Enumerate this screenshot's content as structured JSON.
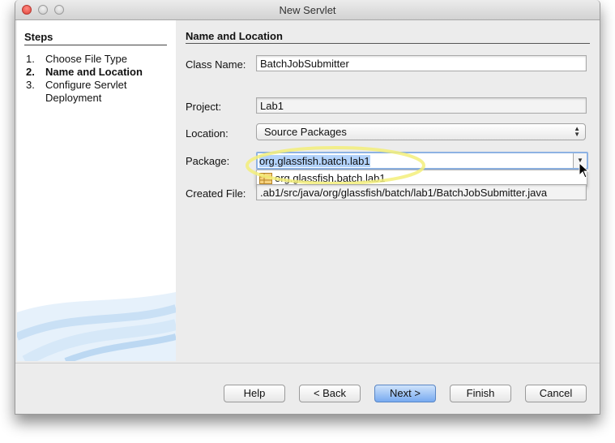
{
  "window": {
    "title": "New Servlet"
  },
  "steps": {
    "heading": "Steps",
    "items": [
      {
        "number": "1.",
        "label": "Choose File Type"
      },
      {
        "number": "2.",
        "label": "Name and Location"
      },
      {
        "number": "3.",
        "label": "Configure Servlet Deployment"
      }
    ]
  },
  "section": {
    "heading": "Name and Location"
  },
  "form": {
    "class_name": {
      "label": "Class Name:",
      "value": "BatchJobSubmitter"
    },
    "project": {
      "label": "Project:",
      "value": "Lab1"
    },
    "location": {
      "label": "Location:",
      "value": "Source Packages"
    },
    "package": {
      "label": "Package:",
      "value": "org.glassfish.batch.lab1",
      "options": [
        "org.glassfish.batch.lab1"
      ]
    },
    "created_file": {
      "label": "Created File:",
      "value": ".ab1/src/java/org/glassfish/batch/lab1/BatchJobSubmitter.java"
    }
  },
  "buttons": {
    "help": "Help",
    "back": "< Back",
    "next": "Next >",
    "finish": "Finish",
    "cancel": "Cancel"
  },
  "colors": {
    "highlight_ring": "#f3ee7a",
    "selection": "#b3d3fb",
    "primary_button": "#78aaf0"
  }
}
